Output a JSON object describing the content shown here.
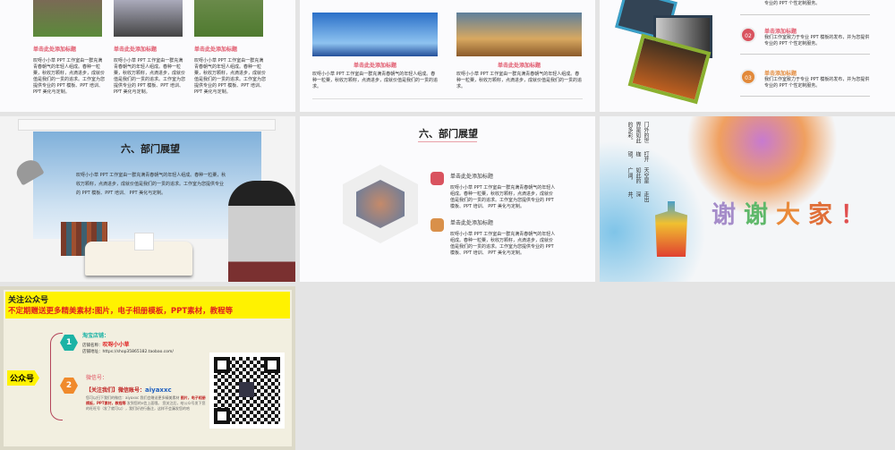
{
  "body_text": "叹呀小小草 PPT 工作室由一群充满青春朝气的年轻人组成。春种一粒粟，秋收万颗籽，点滴进步，成就价值是我们的一贯的追求。工作室为您提供专业的 PPT 模板、PPT 培训、 PPT 美化与定制。",
  "short_text": "叹呀小小草 PPT 工作室由一群充满青春朝气的年轻人组成。春种一粒粟，秋收万颗籽，点滴进步，成就价值是我们的一贯的追求。",
  "service_text": "我们工作室致力于专业 PPT 模板的发布，并为您提供专业的 PPT 个性定制服务。",
  "slide1": {
    "titles": [
      "单击此处添加标题",
      "单击此处添加标题",
      "单击此处添加标题"
    ]
  },
  "slide2": {
    "titles": [
      "单击此处添加标题",
      "单击此处添加标题"
    ]
  },
  "slide3": {
    "items": [
      {
        "num": "02",
        "title": "单击添加标题"
      },
      {
        "num": "03",
        "title": "单击添加标题"
      }
    ]
  },
  "slide4": {
    "title": "六、部门展望"
  },
  "slide5": {
    "title": "六、部门展望",
    "items": [
      "单击此处添加标题",
      "单击此处添加标题"
    ]
  },
  "slide6": {
    "poem": [
      "走出深井，",
      "天空是如此的广阔，",
      "打开枷锁，",
      "门外的世界是如此的多彩。"
    ],
    "thanks": [
      "谢",
      "谢",
      "大",
      "家",
      "！"
    ]
  },
  "slide7": {
    "header1": "关注公众号",
    "header2": "不定期赠送更多精美素材:图片，电子相册模板，PPT素材，教程等",
    "label": "公众号",
    "step1": {
      "num": "1",
      "title": "淘宝店铺：",
      "name_label": "店铺名称：",
      "name": "叹呀小小草",
      "url": "店铺地址：https://shop35865182.taobao.com/"
    },
    "step2": {
      "num": "2",
      "title": "微信号：",
      "follow": "【关注我们】微信账号：",
      "account": "aiyaxxc",
      "desc1": "您可以扫下我们的微信：aiyaxxc 我们会赠送更多精美素材",
      "desc2": "图片，电子相册模板，PPT素材，教程等",
      "desc3": "发到您的v信上面哦。",
      "desc4": "您关注后，给公众号发下您的旺旺号（发了就可以），我们好进行备注，这样不会漏发您的哈"
    }
  },
  "colors": {
    "accent": "#e0566a",
    "yellow": "#fff200",
    "teal": "#1bb3a5",
    "orange": "#f08a2c"
  }
}
